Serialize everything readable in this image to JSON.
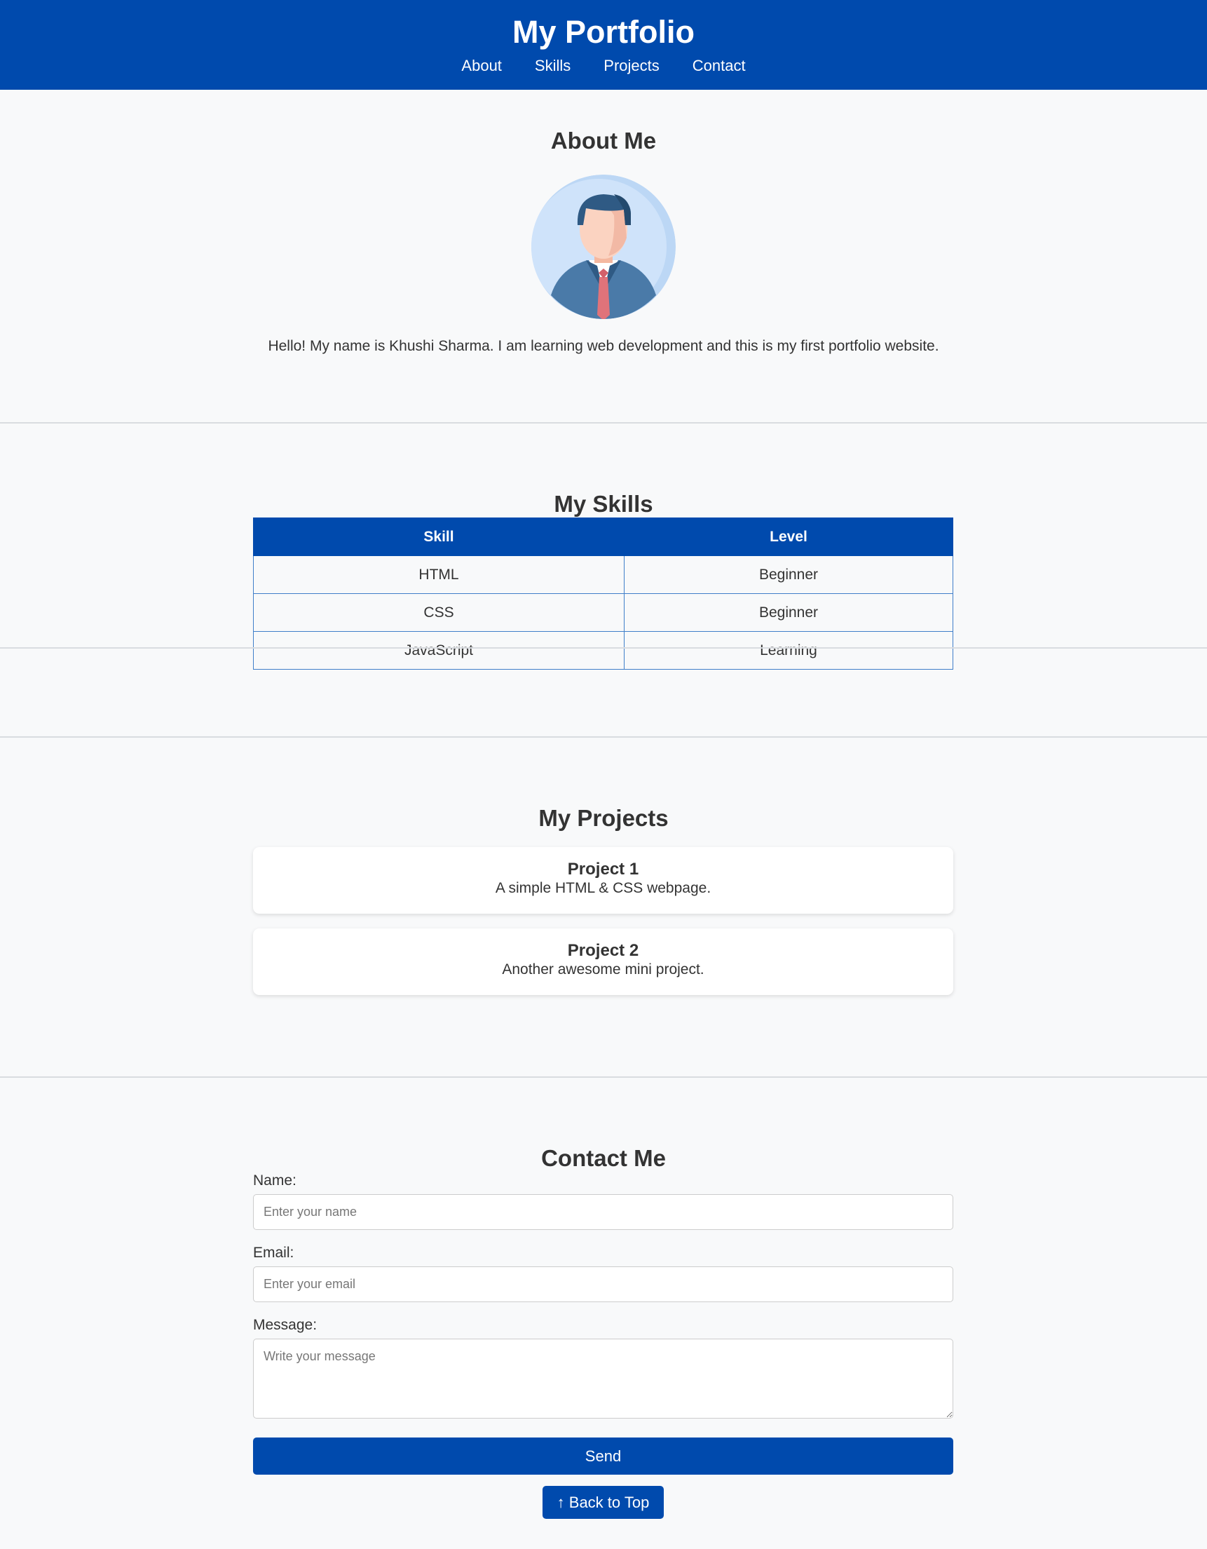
{
  "header": {
    "title": "My Portfolio",
    "nav": [
      "About",
      "Skills",
      "Projects",
      "Contact"
    ]
  },
  "about": {
    "heading": "About Me",
    "avatar_icon": "person-avatar-icon",
    "text": "Hello! My name is Khushi Sharma. I am learning web development and this is my first portfolio website."
  },
  "skills": {
    "heading": "My Skills",
    "columns": [
      "Skill",
      "Level"
    ],
    "rows": [
      [
        "HTML",
        "Beginner"
      ],
      [
        "CSS",
        "Beginner"
      ],
      [
        "JavaScript",
        "Learning"
      ]
    ]
  },
  "projects": {
    "heading": "My Projects",
    "items": [
      {
        "title": "Project 1",
        "description": "A simple HTML & CSS webpage."
      },
      {
        "title": "Project 2",
        "description": "Another awesome mini project."
      }
    ]
  },
  "contact": {
    "heading": "Contact Me",
    "name_label": "Name:",
    "name_placeholder": "Enter your name",
    "email_label": "Email:",
    "email_placeholder": "Enter your email",
    "message_label": "Message:",
    "message_placeholder": "Write your message",
    "send_label": "Send",
    "back_to_top_label": "↑ Back to Top"
  },
  "colors": {
    "brand": "#004aad",
    "background": "#f8f9fa",
    "text": "#333333"
  }
}
